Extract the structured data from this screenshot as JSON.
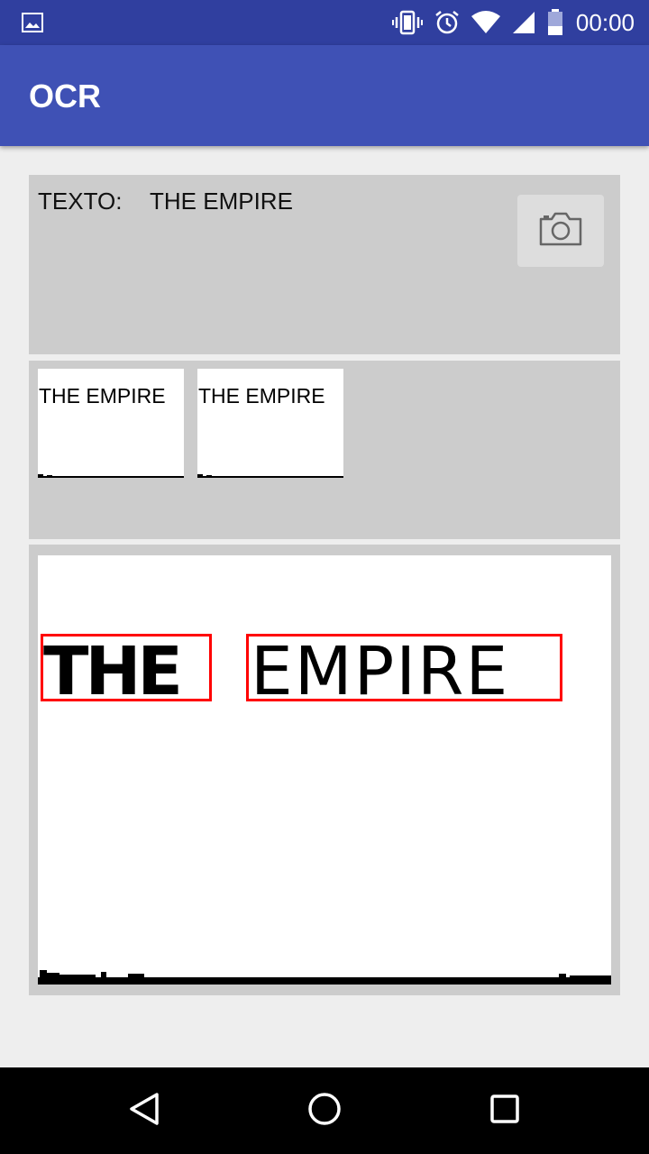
{
  "status_bar": {
    "time": "00:00",
    "icons": [
      "image-notification-icon",
      "vibrate-icon",
      "alarm-icon",
      "wifi-icon",
      "signal-icon",
      "battery-icon"
    ]
  },
  "app_bar": {
    "title": "OCR"
  },
  "result": {
    "label": "TEXTO:",
    "value": "THE EMPIRE",
    "camera_icon": "camera-icon"
  },
  "thumbnails": [
    {
      "text": "THE EMPIRE"
    },
    {
      "text": "THE EMPIRE"
    }
  ],
  "detected_image": {
    "words": [
      "THE",
      "EMPIRE"
    ],
    "box_color": "#ff0000"
  },
  "nav_bar": {
    "icons": [
      "back-icon",
      "home-icon",
      "recent-apps-icon"
    ]
  },
  "colors": {
    "primary": "#3f51b5",
    "primary_dark": "#303f9f",
    "panel": "#cccccc",
    "background": "#eeeeee"
  }
}
